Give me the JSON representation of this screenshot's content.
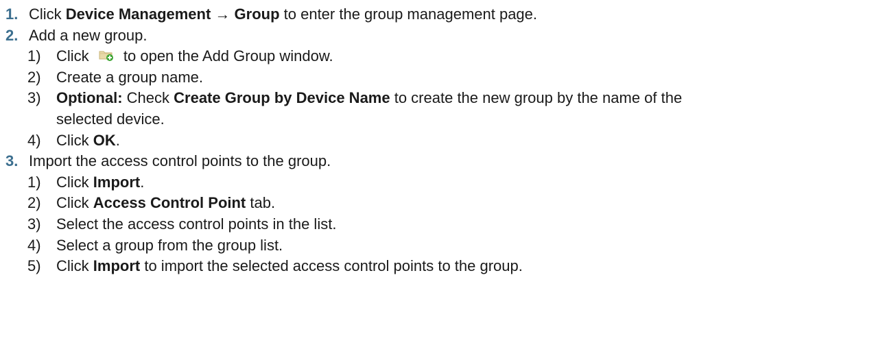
{
  "steps": [
    {
      "num": "1.",
      "prefix": "Click ",
      "bold": "Device Management → Group",
      "suffix": " to enter the group management page."
    },
    {
      "num": "2.",
      "text": "Add a new group.",
      "substeps": [
        {
          "num": "1)",
          "prefix": "Click ",
          "icon": "add-group-icon",
          "suffix": " to open the Add Group window."
        },
        {
          "num": "2)",
          "text": "Create a group name."
        },
        {
          "num": "3)",
          "bold1": "Optional:",
          "mid1": " Check ",
          "bold2": "Create Group by Device Name",
          "suffix": " to create the new group by the name of the",
          "continuation": "selected device."
        },
        {
          "num": "4)",
          "prefix": "Click ",
          "bold": "OK",
          "suffix": "."
        }
      ]
    },
    {
      "num": "3.",
      "text": "Import the access control points to the group.",
      "substeps": [
        {
          "num": "1)",
          "prefix": "Click ",
          "bold": "Import",
          "suffix": "."
        },
        {
          "num": "2)",
          "prefix": "Click ",
          "bold": "Access Control Point",
          "suffix": " tab."
        },
        {
          "num": "3)",
          "text": "Select the access control points in the list."
        },
        {
          "num": "4)",
          "text": "Select a group from the group list."
        },
        {
          "num": "5)",
          "prefix": "Click ",
          "bold": "Import",
          "suffix": " to import the selected access control points to the group."
        }
      ]
    }
  ],
  "colors": {
    "step_number": "#3c6f8f",
    "text": "#1a1a1a",
    "icon_folder": "#e8d9a8",
    "icon_plus": "#3fa535"
  }
}
